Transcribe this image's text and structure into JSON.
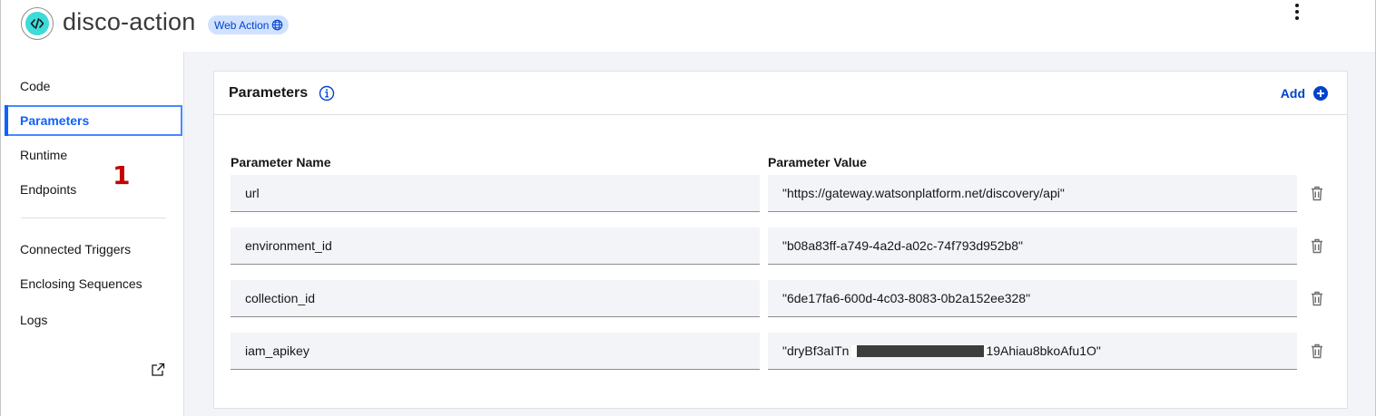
{
  "header": {
    "title": "disco-action",
    "badge": "Web Action",
    "icons": {
      "action": "code-icon",
      "badge": "globe-icon",
      "menu": "overflow-menu-icon"
    }
  },
  "sidebar": {
    "items": [
      {
        "label": "Code",
        "selected": false
      },
      {
        "label": "Parameters",
        "selected": true
      },
      {
        "label": "Runtime",
        "selected": false
      },
      {
        "label": "Endpoints",
        "selected": false
      },
      {
        "label": "Connected Triggers",
        "selected": false
      },
      {
        "label": "Enclosing Sequences",
        "selected": false
      },
      {
        "label": "Logs",
        "selected": false,
        "icon": "external-link-icon"
      }
    ],
    "annotation": "1"
  },
  "parameters": {
    "title": "Parameters",
    "add_label": "Add",
    "columns": {
      "name": "Parameter Name",
      "value": "Parameter Value"
    },
    "rows": [
      {
        "name": "url",
        "value": "\"https://gateway.watsonplatform.net/discovery/api\""
      },
      {
        "name": "environment_id",
        "value": "\"b08a83ff-a749-4a2d-a02c-74f793d952b8\""
      },
      {
        "name": "collection_id",
        "value": "\"6de17fa6-600d-4c03-8083-0b2a152ee328\""
      },
      {
        "name": "iam_apikey",
        "value_prefix": "\"dryBf3aITn",
        "value_suffix": "19Ahiau8bkoAfu1O\"",
        "redacted": true
      }
    ]
  },
  "colors": {
    "accent": "#0f62fe",
    "link": "#0043ce",
    "badge_bg": "#d0e2ff",
    "icon_teal": "#3ddbd9",
    "annotation": "#c40000"
  }
}
